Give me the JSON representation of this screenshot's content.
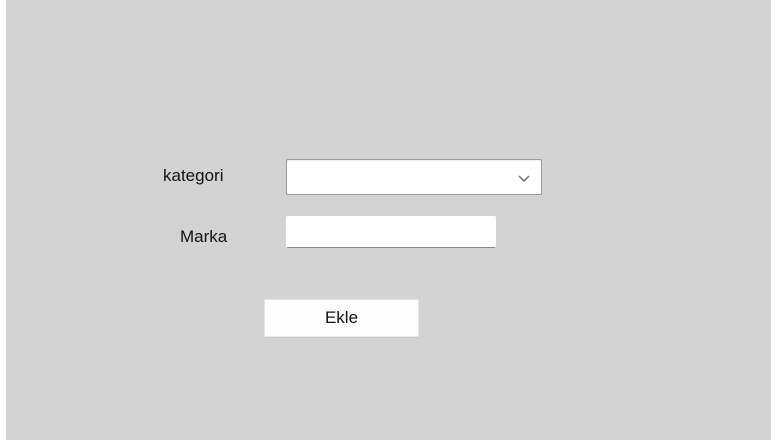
{
  "form": {
    "kategori_label": "kategori",
    "kategori_value": "",
    "marka_label": "Marka",
    "marka_value": "",
    "ekle_button_label": "Ekle"
  },
  "icons": {
    "dropdown": "chevron-down-icon"
  },
  "colors": {
    "panel_background": "#d3d3d3",
    "input_background": "#ffffff"
  }
}
